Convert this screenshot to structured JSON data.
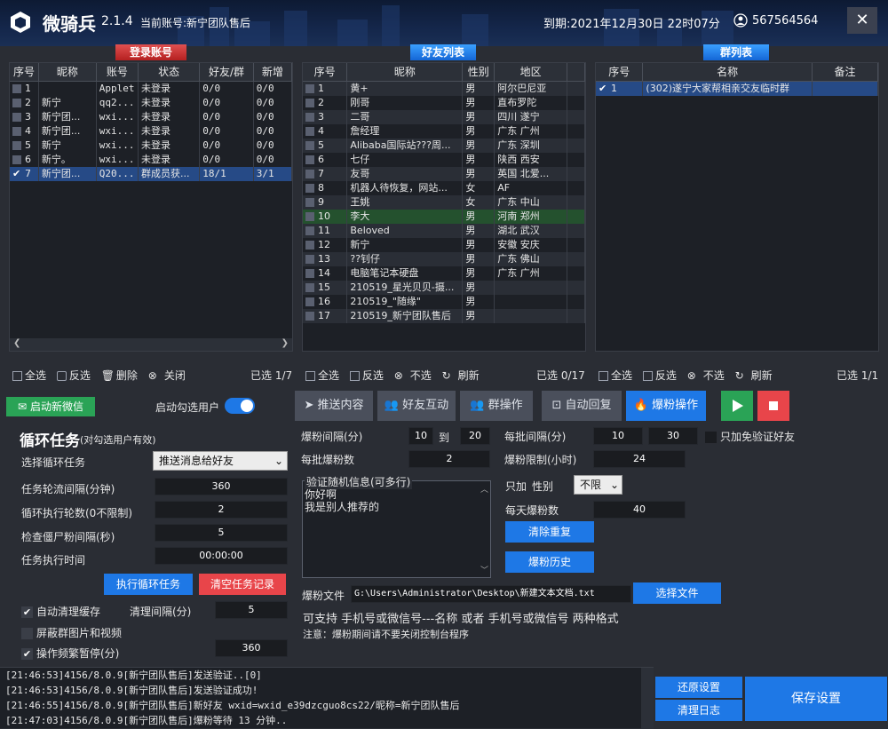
{
  "app": {
    "name": "微骑兵",
    "version": "2.1.4",
    "account": "当前账号:新宁团队售后",
    "expire": "到期:2021年12月30日 22时07分",
    "user_id": "567564564",
    "close": "✕"
  },
  "login_panel": {
    "title": "登录账号",
    "columns": [
      "序号",
      "昵称",
      "账号",
      "状态",
      "好友/群",
      "新增"
    ],
    "rows": [
      {
        "idx": "1",
        "nick": "",
        "acct": "Applet",
        "status": "未登录",
        "fg": "0/0",
        "new": "0/0",
        "checked": false
      },
      {
        "idx": "2",
        "nick": "新宁",
        "acct": "qq2...",
        "status": "未登录",
        "fg": "0/0",
        "new": "0/0",
        "checked": false
      },
      {
        "idx": "3",
        "nick": "新宁团...",
        "acct": "wxi...",
        "status": "未登录",
        "fg": "0/0",
        "new": "0/0",
        "checked": false
      },
      {
        "idx": "4",
        "nick": "新宁团...",
        "acct": "wxi...",
        "status": "未登录",
        "fg": "0/0",
        "new": "0/0",
        "checked": false
      },
      {
        "idx": "5",
        "nick": "新宁",
        "acct": "wxi...",
        "status": "未登录",
        "fg": "0/0",
        "new": "0/0",
        "checked": false
      },
      {
        "idx": "6",
        "nick": "新宁。",
        "acct": "wxi...",
        "status": "未登录",
        "fg": "0/0",
        "new": "0/0",
        "checked": false
      },
      {
        "idx": "7",
        "nick": "新宁团...",
        "acct": "Q20...",
        "status": "群成员获...",
        "fg": "18/1",
        "new": "3/1",
        "checked": true
      }
    ],
    "footer": {
      "select_all": "全选",
      "invert": "反选",
      "delete": "删除",
      "close": "关闭",
      "selected": "已选 1/7"
    }
  },
  "friend_panel": {
    "title": "好友列表",
    "columns": [
      "序号",
      "昵称",
      "性别",
      "地区"
    ],
    "rows": [
      {
        "idx": "1",
        "nick": "黄+",
        "sex": "男",
        "region": "阿尔巴尼亚"
      },
      {
        "idx": "2",
        "nick": "刚哥",
        "sex": "男",
        "region": "直布罗陀"
      },
      {
        "idx": "3",
        "nick": "二哥",
        "sex": "男",
        "region": "四川 遂宁"
      },
      {
        "idx": "4",
        "nick": "詹经理",
        "sex": "男",
        "region": "广东 广州"
      },
      {
        "idx": "5",
        "nick": "Alibaba国际站???周...",
        "sex": "男",
        "region": "广东 深圳"
      },
      {
        "idx": "6",
        "nick": "七仔",
        "sex": "男",
        "region": "陕西 西安"
      },
      {
        "idx": "7",
        "nick": "友哥",
        "sex": "男",
        "region": "英国 北爱..."
      },
      {
        "idx": "8",
        "nick": "机器人待恢复，网站...",
        "sex": "女",
        "region": "AF"
      },
      {
        "idx": "9",
        "nick": "王姚",
        "sex": "女",
        "region": "广东 中山"
      },
      {
        "idx": "10",
        "nick": "李大",
        "sex": "男",
        "region": "河南 郑州"
      },
      {
        "idx": "11",
        "nick": "Beloved",
        "sex": "男",
        "region": "湖北 武汉"
      },
      {
        "idx": "12",
        "nick": "新宁",
        "sex": "男",
        "region": "安徽 安庆"
      },
      {
        "idx": "13",
        "nick": "??钊仔",
        "sex": "男",
        "region": "广东 佛山"
      },
      {
        "idx": "14",
        "nick": "电脑笔记本硬盘",
        "sex": "男",
        "region": "广东 广州"
      },
      {
        "idx": "15",
        "nick": "210519_星光贝贝-摄...",
        "sex": "男",
        "region": ""
      },
      {
        "idx": "16",
        "nick": "210519_\"随缘\"",
        "sex": "男",
        "region": ""
      },
      {
        "idx": "17",
        "nick": "210519_新宁团队售后",
        "sex": "男",
        "region": ""
      }
    ],
    "footer": {
      "select_all": "全选",
      "invert": "反选",
      "unselect": "不选",
      "refresh": "刷新",
      "selected": "已选 0/17"
    }
  },
  "group_panel": {
    "title": "群列表",
    "columns": [
      "序号",
      "名称",
      "备注"
    ],
    "rows": [
      {
        "idx": "1",
        "name": "(302)遂宁大家帮相亲交友临时群",
        "note": "",
        "checked": true
      }
    ],
    "footer": {
      "select_all": "全选",
      "invert": "反选",
      "unselect": "不选",
      "refresh": "刷新",
      "selected": "已选 1/1"
    }
  },
  "loop": {
    "start_wechat": "启动新微信",
    "auto_select": "启动勾选用户",
    "title": "循环任务",
    "subtitle": "(对勾选用户有效)",
    "choose_label": "选择循环任务",
    "choose_value": "推送消息给好友",
    "interval_label": "任务轮流间隔(分钟)",
    "interval_value": "360",
    "rounds_label": "循环执行轮数(0不限制)",
    "rounds_value": "2",
    "zombie_label": "检查僵尸粉间隔(秒)",
    "zombie_value": "5",
    "time_label": "任务执行时间",
    "time_value": "00:00:00",
    "exec_btn": "执行循环任务",
    "clear_btn": "清空任务记录",
    "auto_clean": "自动清理缓存",
    "clean_interval_label": "清理间隔(分)",
    "clean_interval_value": "5",
    "block_media": "屏蔽群图片和视频",
    "pause_label": "操作频繁暂停(分)",
    "pause_value": "360"
  },
  "tabs": [
    "推送内容",
    "好友互动",
    "群操作",
    "自动回复",
    "爆粉操作"
  ],
  "fan": {
    "interval_label": "爆粉间隔(分)",
    "interval_from": "10",
    "to": "到",
    "interval_to": "20",
    "batch_interval_label": "每批间隔(分)",
    "batch_from": "10",
    "batch_to": "30",
    "only_free": "只加免验证好友",
    "per_batch_label": "每批爆粉数",
    "per_batch_value": "2",
    "limit_label": "爆粉限制(小时)",
    "limit_value": "24",
    "verify_legend": "验证随机信息(可多行)",
    "verify_lines": [
      "你好啊",
      "我是别人推荐的"
    ],
    "only_add": "只加",
    "sex_label": "性别",
    "sex_value": "不限",
    "daily_label": "每天爆粉数",
    "daily_value": "40",
    "dedupe_btn": "清除重复",
    "history_btn": "爆粉历史",
    "file_label": "爆粉文件",
    "file_path": "G:\\Users\\Administrator\\Desktop\\新建文本文档.txt",
    "choose_file": "选择文件",
    "support": "可支持 手机号或微信号---名称 或者 手机号或微信号 两种格式",
    "note": "注意：爆粉期间请不要关闭控制台程序"
  },
  "log": [
    "[21:46:53]4156/8.0.9[新宁团队售后]发送验证..[0]",
    "[21:46:53]4156/8.0.9[新宁团队售后]发送验证成功!",
    "[21:46:55]4156/8.0.9[新宁团队售后]新好友 wxid=wxid_e39dzcguo8cs22/昵称=新宁团队售后",
    "[21:47:03]4156/8.0.9[新宁团队售后]爆粉等待 13 分钟.."
  ],
  "buttons": {
    "restore": "还原设置",
    "clear_log": "清理日志",
    "save": "保存设置"
  },
  "colors": {
    "accent": "#1e78e6",
    "danger": "#e8454a",
    "play": "#2aa356"
  }
}
